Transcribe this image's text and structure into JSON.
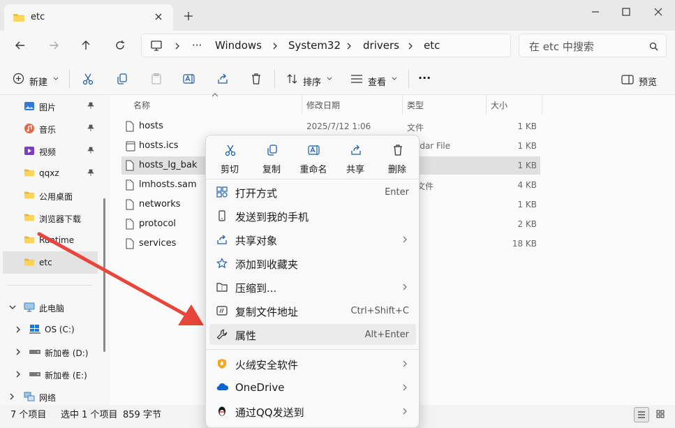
{
  "window": {
    "tab_title": "etc",
    "colors": {
      "accent": "#0067c0",
      "folder": "#f4c13b",
      "arrow": "#e8453c"
    }
  },
  "address": {
    "crumbs": [
      "Windows",
      "System32",
      "drivers",
      "etc"
    ],
    "more": "···",
    "search_placeholder": "在 etc 中搜索"
  },
  "toolbar": {
    "new_label": "新建",
    "sort_label": "排序",
    "view_label": "查看",
    "more_label": "···",
    "preview_label": "预览"
  },
  "sidebar": {
    "pinned": [
      {
        "label": "图片",
        "icon": "pictures-icon"
      },
      {
        "label": "音乐",
        "icon": "music-icon"
      },
      {
        "label": "视频",
        "icon": "video-icon"
      },
      {
        "label": "qqxz",
        "icon": "folder-icon"
      },
      {
        "label": "公用桌面",
        "icon": "folder-icon"
      },
      {
        "label": "浏览器下载",
        "icon": "folder-icon"
      },
      {
        "label": "Runtime",
        "icon": "folder-icon"
      },
      {
        "label": "etc",
        "icon": "folder-icon"
      }
    ],
    "this_pc": "此电脑",
    "drives": [
      {
        "label": "OS (C:)"
      },
      {
        "label": "新加卷 (D:)"
      },
      {
        "label": "新加卷 (E:)"
      }
    ],
    "network": "网络"
  },
  "columns": {
    "name": "名称",
    "date": "修改日期",
    "type": "类型",
    "size": "大小"
  },
  "files": [
    {
      "name": "hosts",
      "date": "2025/7/12 1:06",
      "type": "文件",
      "size": "1 KB"
    },
    {
      "name": "hosts.ics",
      "date": "",
      "type": "lendar File",
      "size": "1 KB"
    },
    {
      "name": "hosts_lg_bak",
      "date": "",
      "type": "件",
      "size": "1 KB"
    },
    {
      "name": "lmhosts.sam",
      "date": "",
      "type": "M 文件",
      "size": "4 KB"
    },
    {
      "name": "networks",
      "date": "",
      "type": "件",
      "size": "1 KB"
    },
    {
      "name": "protocol",
      "date": "",
      "type": "件",
      "size": "2 KB"
    },
    {
      "name": "services",
      "date": "",
      "type": "件",
      "size": "18 KB"
    }
  ],
  "status": {
    "count": "7 个项目",
    "selection": "选中 1 个项目",
    "size": "859 字节"
  },
  "context_menu": {
    "quick_actions": [
      {
        "label": "剪切",
        "icon": "cut-icon"
      },
      {
        "label": "复制",
        "icon": "copy-icon"
      },
      {
        "label": "重命名",
        "icon": "rename-icon"
      },
      {
        "label": "共享",
        "icon": "share-icon"
      },
      {
        "label": "删除",
        "icon": "delete-icon"
      }
    ],
    "items": [
      {
        "label": "打开方式",
        "shortcut": "Enter"
      },
      {
        "label": "发送到我的手机",
        "shortcut": ""
      },
      {
        "label": "共享对象",
        "shortcut": ""
      },
      {
        "label": "添加到收藏夹",
        "shortcut": ""
      },
      {
        "label": "压缩到...",
        "shortcut": ""
      },
      {
        "label": "复制文件地址",
        "shortcut": "Ctrl+Shift+C"
      },
      {
        "label": "属性",
        "shortcut": "Alt+Enter"
      },
      {
        "label": "火绒安全软件",
        "shortcut": ""
      },
      {
        "label": "OneDrive",
        "shortcut": ""
      },
      {
        "label": "通过QQ发送到",
        "shortcut": ""
      }
    ]
  }
}
